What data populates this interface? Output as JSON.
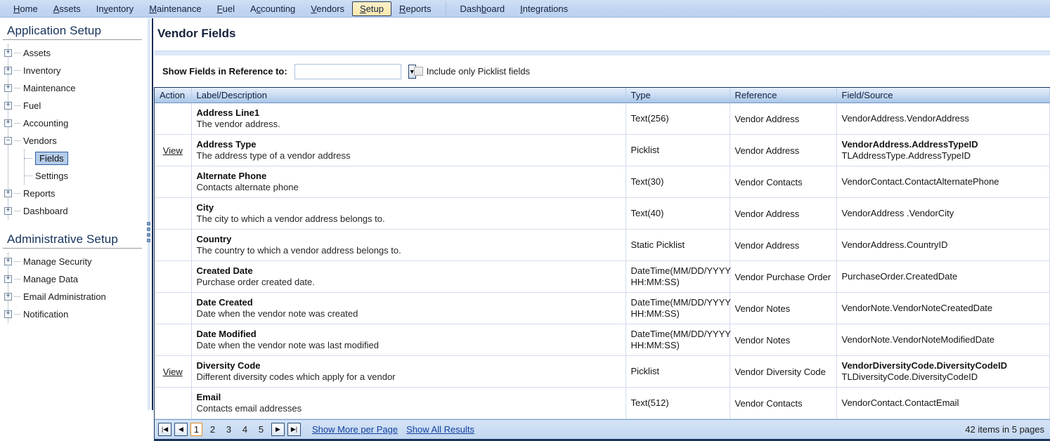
{
  "topnav": {
    "items": [
      {
        "label": "Home",
        "accel": "H",
        "active": false
      },
      {
        "label": "Assets",
        "accel": "A",
        "active": false
      },
      {
        "label": "Inventory",
        "accel": "v",
        "active": false
      },
      {
        "label": "Maintenance",
        "accel": "M",
        "active": false
      },
      {
        "label": "Fuel",
        "accel": "F",
        "active": false
      },
      {
        "label": "Accounting",
        "accel": "c",
        "active": false
      },
      {
        "label": "Vendors",
        "accel": "V",
        "active": false
      },
      {
        "label": "Setup",
        "accel": "S",
        "active": true
      },
      {
        "label": "Reports",
        "accel": "R",
        "active": false
      }
    ],
    "right_items": [
      {
        "label": "Dashboard",
        "accel": "b"
      },
      {
        "label": "Integrations",
        "accel": "I"
      }
    ]
  },
  "sidebar": {
    "app_setup_heading": "Application Setup",
    "admin_setup_heading": "Administrative Setup",
    "app_items": [
      {
        "label": "Assets",
        "state": "collapsed"
      },
      {
        "label": "Inventory",
        "state": "collapsed"
      },
      {
        "label": "Maintenance",
        "state": "collapsed"
      },
      {
        "label": "Fuel",
        "state": "collapsed"
      },
      {
        "label": "Accounting",
        "state": "collapsed"
      },
      {
        "label": "Vendors",
        "state": "expanded"
      },
      {
        "label": "Reports",
        "state": "collapsed"
      },
      {
        "label": "Dashboard",
        "state": "collapsed"
      }
    ],
    "vendors_children": [
      {
        "label": "Fields",
        "selected": true
      },
      {
        "label": "Settings",
        "selected": false
      }
    ],
    "admin_items": [
      {
        "label": "Manage Security",
        "state": "collapsed"
      },
      {
        "label": "Manage Data",
        "state": "collapsed"
      },
      {
        "label": "Email Administration",
        "state": "collapsed"
      },
      {
        "label": "Notification",
        "state": "collapsed"
      }
    ]
  },
  "page": {
    "title": "Vendor Fields"
  },
  "filter": {
    "label": "Show Fields in Reference to:",
    "select_value": "",
    "select_placeholder": "",
    "dropdown_glyph": "▼",
    "checkbox_label": "Include only Picklist fields",
    "checkbox_checked": false
  },
  "grid": {
    "columns": [
      "Action",
      "Label/Description",
      "Type",
      "Reference",
      "Field/Source"
    ],
    "rows": [
      {
        "action": "",
        "label": "Address Line1",
        "description": "The vendor address.",
        "type": "Text(256)",
        "reference": "Vendor Address",
        "field_source": "VendorAddress.VendorAddress",
        "field_source_sub": ""
      },
      {
        "action": "View",
        "label": "Address Type",
        "description": "The address type of a vendor address",
        "type": "Picklist",
        "reference": "Vendor Address",
        "field_source": "VendorAddress.AddressTypeID",
        "field_source_sub": "TLAddressType.AddressTypeID"
      },
      {
        "action": "",
        "label": "Alternate Phone",
        "description": "Contacts alternate phone",
        "type": "Text(30)",
        "reference": "Vendor Contacts",
        "field_source": "VendorContact.ContactAlternatePhone",
        "field_source_sub": ""
      },
      {
        "action": "",
        "label": "City",
        "description": "The city to which a vendor address belongs to.",
        "type": "Text(40)",
        "reference": "Vendor Address",
        "field_source": "VendorAddress .VendorCity",
        "field_source_sub": ""
      },
      {
        "action": "",
        "label": "Country",
        "description": "The country to which a vendor address belongs to.",
        "type": "Static Picklist",
        "reference": "Vendor Address",
        "field_source": "VendorAddress.CountryID",
        "field_source_sub": ""
      },
      {
        "action": "",
        "label": "Created Date",
        "description": "Purchase order created date.",
        "type": "DateTime(MM/DD/YYYY HH:MM:SS)",
        "reference": "Vendor Purchase Order",
        "field_source": "PurchaseOrder.CreatedDate",
        "field_source_sub": ""
      },
      {
        "action": "",
        "label": "Date Created",
        "description": "Date when the vendor note was created",
        "type": "DateTime(MM/DD/YYYY HH:MM:SS)",
        "reference": "Vendor Notes",
        "field_source": "VendorNote.VendorNoteCreatedDate",
        "field_source_sub": ""
      },
      {
        "action": "",
        "label": "Date Modified",
        "description": "Date when the vendor note was last modified",
        "type": "DateTime(MM/DD/YYYY HH:MM:SS)",
        "reference": "Vendor Notes",
        "field_source": "VendorNote.VendorNoteModifiedDate",
        "field_source_sub": ""
      },
      {
        "action": "View",
        "label": "Diversity Code",
        "description": "Different diversity codes which apply for a vendor",
        "type": "Picklist",
        "reference": "Vendor Diversity Code",
        "field_source": "VendorDiversityCode.DiversityCodeID",
        "field_source_sub": "TLDiversityCode.DiversityCodeID"
      },
      {
        "action": "",
        "label": "Email",
        "description": "Contacts email addresses",
        "type": "Text(512)",
        "reference": "Vendor Contacts",
        "field_source": "VendorContact.ContactEmail",
        "field_source_sub": ""
      }
    ]
  },
  "pager": {
    "first_glyph": "|◀",
    "prev_glyph": "◀",
    "next_glyph": "▶",
    "last_glyph": "▶|",
    "pages": [
      "1",
      "2",
      "3",
      "4",
      "5"
    ],
    "current_page": "1",
    "show_more_label": "Show More per Page",
    "show_all_label": "Show All Results",
    "items_count": "42 items in 5 pages"
  },
  "colors": {
    "nav_bg": "#c3d6f2",
    "active_tab": "#fbe9b0",
    "grid_border": "#19355f",
    "header_grad_bottom": "#a9c6e9",
    "link": "#1340a0",
    "current_page_outline": "#e08a22",
    "selected_node": "#b4ccea"
  }
}
